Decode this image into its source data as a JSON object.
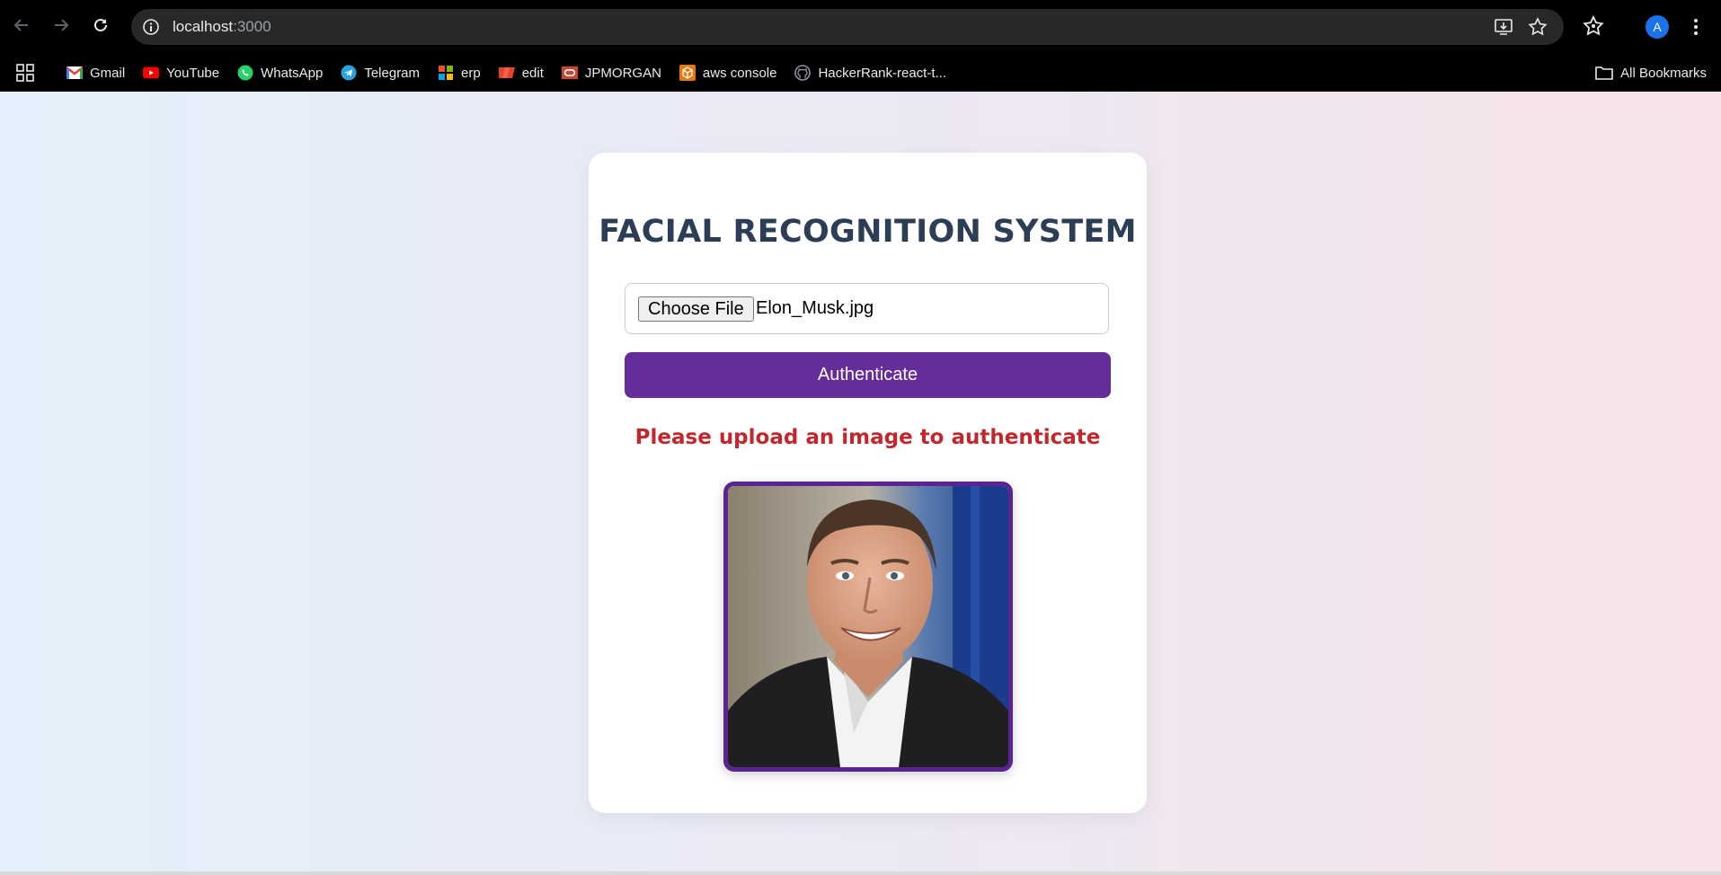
{
  "browser": {
    "url_host": "localhost",
    "url_port": ":3000",
    "profile_initial": "A",
    "bookmarks": [
      {
        "label": "Gmail",
        "icon": "gmail-icon"
      },
      {
        "label": "YouTube",
        "icon": "youtube-icon"
      },
      {
        "label": "WhatsApp",
        "icon": "whatsapp-icon"
      },
      {
        "label": "Telegram",
        "icon": "telegram-icon"
      },
      {
        "label": "erp",
        "icon": "erp-icon"
      },
      {
        "label": "edit",
        "icon": "edit-icon"
      },
      {
        "label": "JPMORGAN",
        "icon": "oracle-icon"
      },
      {
        "label": "aws console",
        "icon": "aws-icon"
      },
      {
        "label": "HackerRank-react-t...",
        "icon": "github-icon"
      }
    ],
    "all_bookmarks_label": "All Bookmarks"
  },
  "app": {
    "title": "FACIAL RECOGNITION SYSTEM",
    "file_button_label": "Choose File",
    "file_name": "Elon_Musk.jpg",
    "authenticate_label": "Authenticate",
    "message": "Please upload an image to authenticate",
    "colors": {
      "button": "#662d99",
      "message": "#c0282d",
      "title": "#2c3e55",
      "photo_border": "#5b2591"
    }
  }
}
